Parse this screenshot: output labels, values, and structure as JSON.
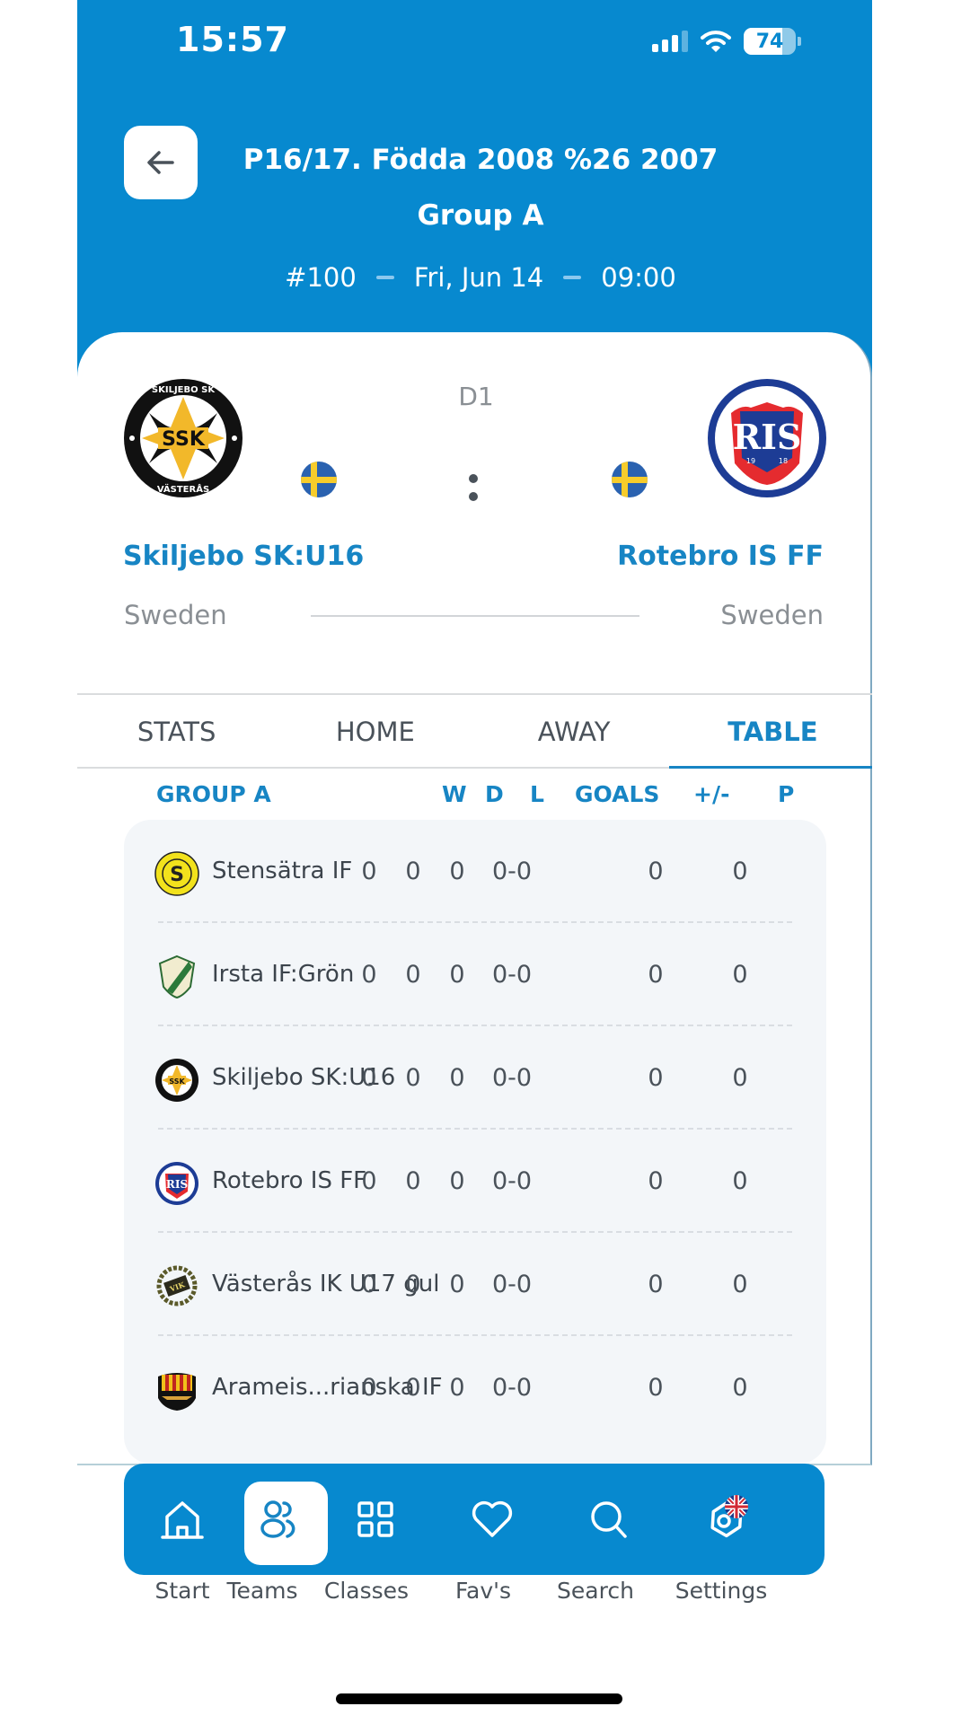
{
  "status_bar": {
    "time": "15:57",
    "battery_percent": 74
  },
  "header": {
    "back_icon": "arrow-left-icon",
    "title": "P16/17. Födda 2008 %26 2007",
    "group": "Group A",
    "match_number": "#100",
    "date": "Fri, Jun 14",
    "time": "09:00"
  },
  "match": {
    "round": "D1",
    "home": {
      "name": "Skiljebo SK:U16",
      "country": "Sweden",
      "flag": "sweden-flag-icon",
      "crest": "skiljebo-sk-crest"
    },
    "away": {
      "name": "Rotebro IS FF",
      "country": "Sweden",
      "flag": "sweden-flag-icon",
      "crest": "rotebro-is-crest"
    }
  },
  "tabs": [
    {
      "label": "STATS",
      "active": false
    },
    {
      "label": "HOME",
      "active": false
    },
    {
      "label": "AWAY",
      "active": false
    },
    {
      "label": "TABLE",
      "active": true
    }
  ],
  "table": {
    "headers": {
      "group": "GROUP A",
      "w": "W",
      "d": "D",
      "l": "L",
      "goals": "GOALS",
      "diff": "+/-",
      "p": "P"
    },
    "rows": [
      {
        "team": "Stensätra IF",
        "crest": "stensatra-crest",
        "w": "0",
        "d": "0",
        "l": "0",
        "goals": "0-0",
        "diff": "0",
        "p": "0"
      },
      {
        "team": "Irsta IF:Grön",
        "crest": "irsta-crest",
        "w": "0",
        "d": "0",
        "l": "0",
        "goals": "0-0",
        "diff": "0",
        "p": "0"
      },
      {
        "team": "Skiljebo SK:U16",
        "crest": "skiljebo-crest",
        "w": "0",
        "d": "0",
        "l": "0",
        "goals": "0-0",
        "diff": "0",
        "p": "0"
      },
      {
        "team": "Rotebro IS FF",
        "crest": "rotebro-crest",
        "w": "0",
        "d": "0",
        "l": "0",
        "goals": "0-0",
        "diff": "0",
        "p": "0"
      },
      {
        "team": "Västerås IK U17 gul",
        "crest": "vasteras-ik-crest",
        "w": "0",
        "d": "0",
        "l": "0",
        "goals": "0-0",
        "diff": "0",
        "p": "0"
      },
      {
        "team": "Arameis...rianska IF",
        "crest": "arameisk-crest",
        "w": "0",
        "d": "0",
        "l": "0",
        "goals": "0-0",
        "diff": "0",
        "p": "0"
      }
    ]
  },
  "nav": [
    {
      "label": "Start",
      "icon": "home-icon",
      "active": false
    },
    {
      "label": "Teams",
      "icon": "users-icon",
      "active": true
    },
    {
      "label": "Classes",
      "icon": "grid-icon",
      "active": false
    },
    {
      "label": "Fav's",
      "icon": "heart-icon",
      "active": false
    },
    {
      "label": "Search",
      "icon": "search-icon",
      "active": false
    },
    {
      "label": "Settings",
      "icon": "settings-icon",
      "active": false,
      "badge": "uk-flag-icon"
    }
  ],
  "colors": {
    "brand_blue": "#0789cf",
    "accent_text": "#1785c4",
    "table_bg": "#f3f6f9"
  }
}
